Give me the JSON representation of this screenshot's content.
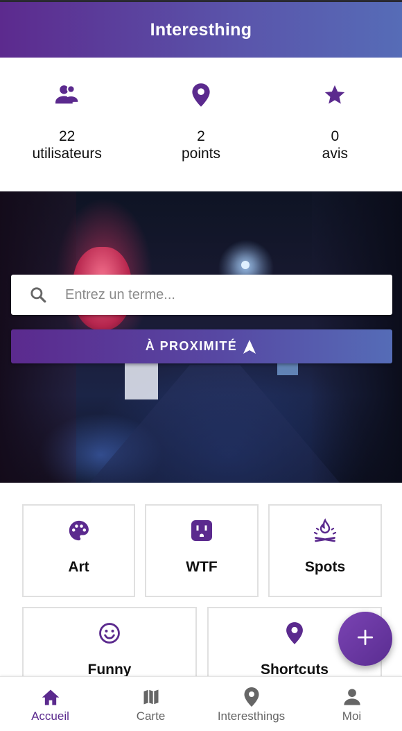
{
  "colors": {
    "primary": "#5b2a8e",
    "primary_end": "#556cb7",
    "inactive": "#666666"
  },
  "appbar": {
    "title": "Interesthing"
  },
  "stats": [
    {
      "icon": "users-icon",
      "value": "22",
      "label": "utilisateurs"
    },
    {
      "icon": "location-pin-icon",
      "value": "2",
      "label": "points"
    },
    {
      "icon": "star-icon",
      "value": "0",
      "label": "avis"
    }
  ],
  "hero": {
    "search_placeholder": "Entrez un terme...",
    "nearby_label": "À PROXIMITÉ",
    "nearby_icon": "navigation-arrow-icon"
  },
  "categories": [
    {
      "icon": "palette-icon",
      "label": "Art"
    },
    {
      "icon": "power-outlet-icon",
      "label": "WTF"
    },
    {
      "icon": "campfire-icon",
      "label": "Spots"
    },
    {
      "icon": "smiley-icon",
      "label": "Funny"
    },
    {
      "icon": "location-pin-icon",
      "label": "Shortcuts"
    }
  ],
  "fab": {
    "icon": "plus-icon"
  },
  "bottom_nav": [
    {
      "icon": "home-icon",
      "label": "Accueil",
      "active": true
    },
    {
      "icon": "map-icon",
      "label": "Carte",
      "active": false
    },
    {
      "icon": "location-pin-icon",
      "label": "Interesthings",
      "active": false
    },
    {
      "icon": "person-icon",
      "label": "Moi",
      "active": false
    }
  ]
}
